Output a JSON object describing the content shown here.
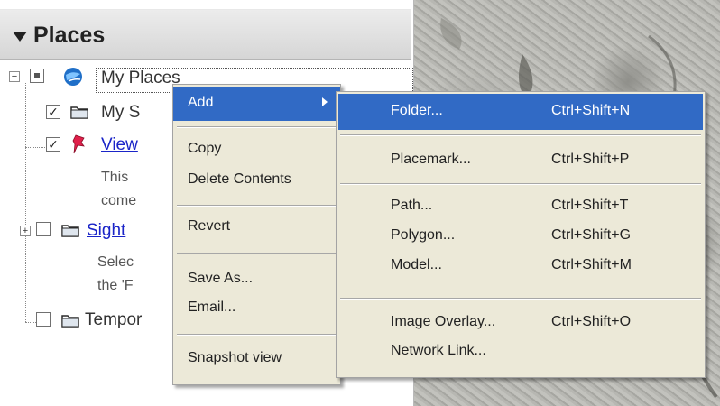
{
  "panel": {
    "title": "Places"
  },
  "tree": {
    "my_places": "My Places",
    "my_s": "My S",
    "view": "View",
    "desc1_line1": "This",
    "desc1_line2": "come",
    "sight": "Sight",
    "desc2_line1": "Selec",
    "desc2_line2": "the 'F",
    "temporary": "Tempor"
  },
  "context_menu": {
    "items": [
      {
        "label": "Add"
      },
      {
        "label": "Copy"
      },
      {
        "label": "Delete Contents"
      },
      {
        "label": "Revert"
      },
      {
        "label": "Save As..."
      },
      {
        "label": "Email..."
      },
      {
        "label": "Snapshot view"
      }
    ]
  },
  "add_submenu": {
    "items": [
      {
        "label": "Folder...",
        "shortcut": "Ctrl+Shift+N"
      },
      {
        "label": "Placemark...",
        "shortcut": "Ctrl+Shift+P"
      },
      {
        "label": "Path...",
        "shortcut": "Ctrl+Shift+T"
      },
      {
        "label": "Polygon...",
        "shortcut": "Ctrl+Shift+G"
      },
      {
        "label": "Model...",
        "shortcut": "Ctrl+Shift+M"
      },
      {
        "label": "Image Overlay...",
        "shortcut": "Ctrl+Shift+O"
      },
      {
        "label": "Network Link...",
        "shortcut": ""
      }
    ]
  },
  "colors": {
    "highlight": "#316ac5",
    "menu_bg": "#ece9d8",
    "link": "#1a24c8"
  },
  "icons": {
    "collapse": "triangle-down-icon",
    "globe": "globe-icon",
    "folder": "folder-icon",
    "pushpin": "pushpin-icon",
    "submenu": "triangle-right-icon"
  }
}
